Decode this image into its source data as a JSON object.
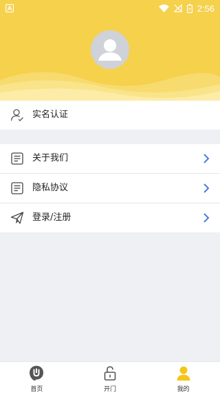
{
  "status_bar": {
    "notification_icon": "a-icon",
    "wifi_icon": "wifi-icon",
    "signal_icon": "no-signal-icon",
    "battery_icon": "battery-charging-icon",
    "time": "2:56"
  },
  "header": {
    "background_color": "#f5d14c",
    "avatar_icon": "user-avatar-icon"
  },
  "menu": {
    "verify": {
      "label": "实名认证",
      "icon": "user-verify-icon"
    },
    "about": {
      "label": "关于我们",
      "icon": "document-icon"
    },
    "privacy": {
      "label": "隐私协议",
      "icon": "document-icon"
    },
    "login": {
      "label": "登录/注册",
      "icon": "paper-plane-icon"
    }
  },
  "tabs": [
    {
      "label": "首页",
      "icon": "home-u-icon"
    },
    {
      "label": "开门",
      "icon": "unlock-icon"
    },
    {
      "label": "我的",
      "icon": "profile-icon",
      "active": true
    }
  ],
  "colors": {
    "accent": "#f5d14c",
    "chevron": "#4a7bdc",
    "active_tab": "#f5c518"
  }
}
